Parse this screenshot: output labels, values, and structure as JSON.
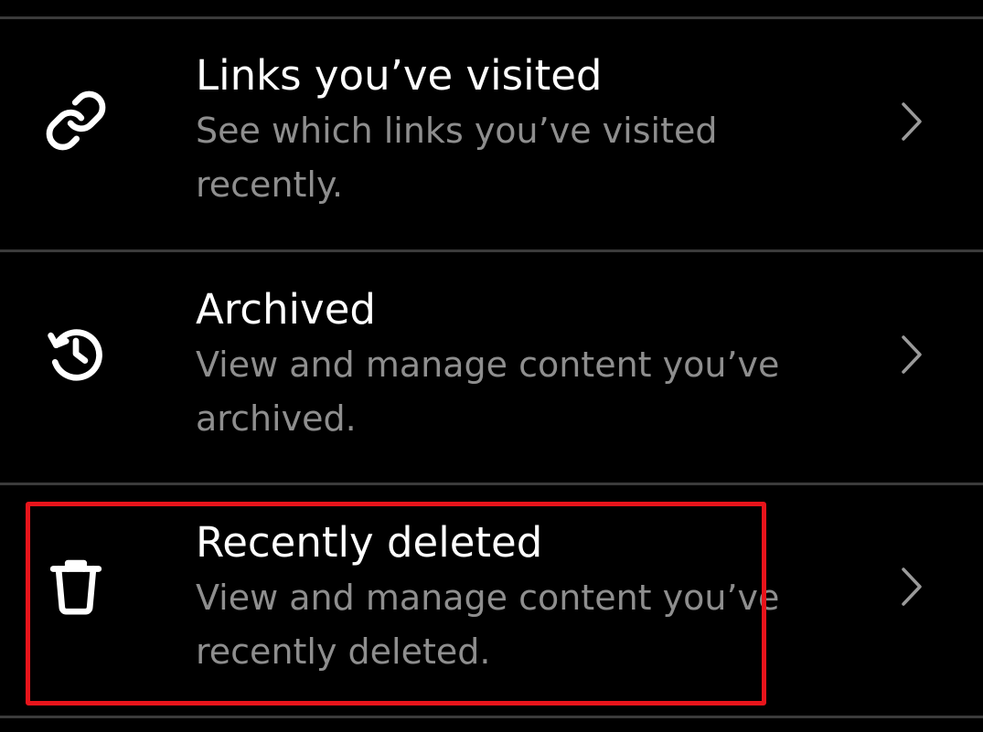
{
  "menu": {
    "items": [
      {
        "title": "Links you’ve visited",
        "subtitle": "See which links you’ve visited recently.",
        "icon": "link-icon"
      },
      {
        "title": "Archived",
        "subtitle": "View and manage content you’ve archived.",
        "icon": "archive-history-icon"
      },
      {
        "title": "Recently deleted",
        "subtitle": "View and manage content you’ve recently deleted.",
        "icon": "trash-icon"
      }
    ]
  },
  "colors": {
    "background": "#000000",
    "title_text": "#ffffff",
    "subtitle_text": "#8e8e8e",
    "divider": "#3b3b3b",
    "highlight_border": "#e8141b"
  }
}
